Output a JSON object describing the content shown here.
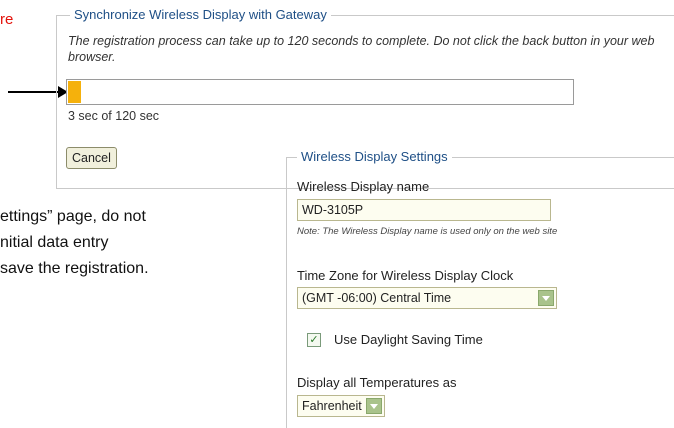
{
  "background_doc": {
    "red_fragment": "re",
    "line1": "ettings” page, do not",
    "line2": "nitial data entry",
    "line3": "save the registration."
  },
  "sync_panel": {
    "legend": "Synchronize Wireless Display with Gateway",
    "description": "The registration process can take up to 120 seconds to complete. Do not click the back button in your web browser.",
    "progress_fraction": 0.025,
    "progress_text": "3 sec of 120 sec",
    "cancel_label": "Cancel"
  },
  "settings_panel": {
    "legend": "Wireless Display Settings",
    "name_label": "Wireless Display name",
    "name_value": "WD-3105P",
    "name_note": "Note: The Wireless Display name is used only on the web site",
    "timezone_label": "Time Zone for Wireless Display Clock",
    "timezone_value": "(GMT -06:00) Central Time",
    "dst_checked": true,
    "dst_label": "Use Daylight Saving Time",
    "temp_label": "Display all Temperatures as",
    "temp_value": "Fahrenheit"
  },
  "colors": {
    "legend_blue": "#1e4f86",
    "progress_orange": "#f5b10c",
    "red_text": "#e3120b"
  }
}
